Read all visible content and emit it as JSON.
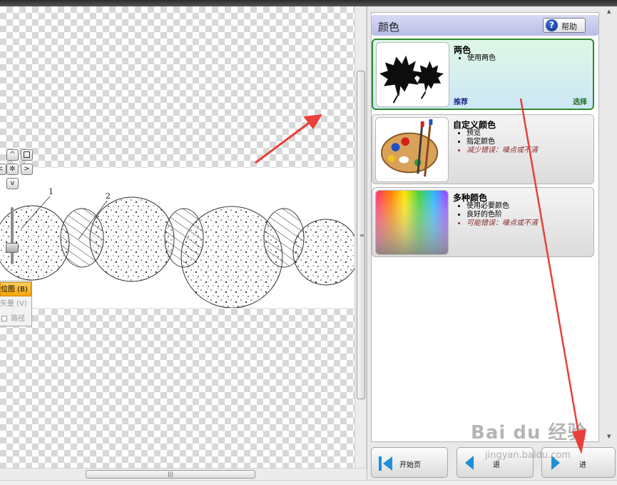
{
  "panel": {
    "title": "颜色",
    "help_label": "帮助"
  },
  "options": [
    {
      "title": "两色",
      "bullets": [
        "使用两色"
      ],
      "warning": "",
      "recommend": "推荐",
      "choose": "选择",
      "selected": true,
      "thumbnail_icon": "maple-leaves-icon"
    },
    {
      "title": "自定义颜色",
      "bullets": [
        "预览",
        "指定颜色"
      ],
      "warning": "减少错误：噪点或不清",
      "selected": false,
      "thumbnail_icon": "paint-palette-icon"
    },
    {
      "title": "多种颜色",
      "bullets": [
        "使用必要颜色",
        "良好的色阶"
      ],
      "warning": "可能错误：噪点或不清",
      "selected": false,
      "thumbnail_icon": "color-spectrum-icon"
    }
  ],
  "footer": {
    "start_label": "开始页",
    "prev_label": "退",
    "next_label": "进"
  },
  "view_menu": {
    "bitmap_label": "位图 (B)",
    "vector_label": "矢量 (V)",
    "path_label": "路径"
  },
  "nav": {
    "up": "^",
    "down": "v",
    "left": "<",
    "right": ">"
  },
  "drawing_labels": [
    "1",
    "2"
  ],
  "watermark": {
    "main": "Bai du 经验",
    "sub": "jingyan.baidu.com"
  },
  "annotation_color": "#e8403a",
  "selected_border_color": "#2f8a2f"
}
